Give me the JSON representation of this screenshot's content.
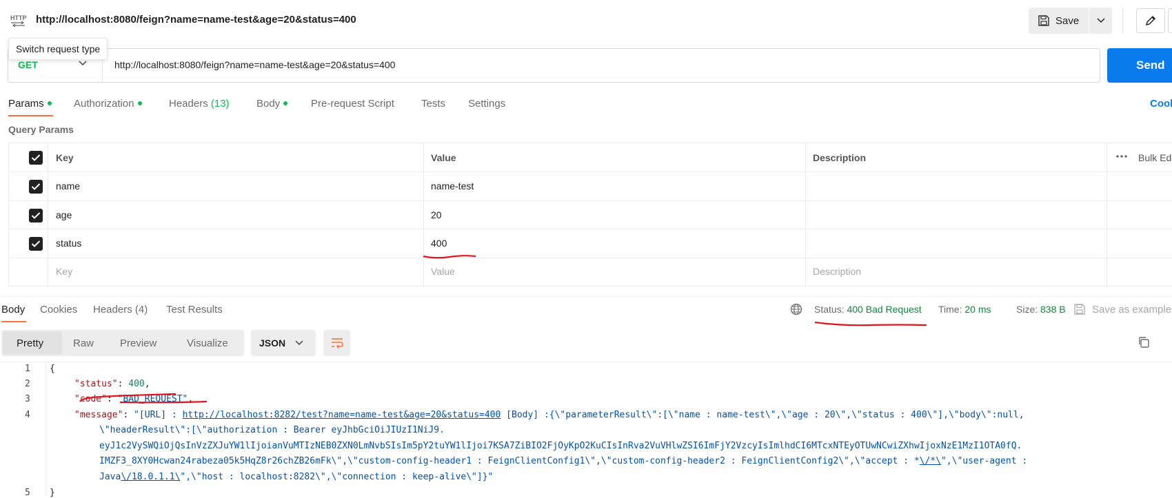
{
  "header": {
    "title": "http://localhost:8080/feign?name=name-test&age=20&status=400",
    "save_label": "Save",
    "tooltip": "Switch request type"
  },
  "request": {
    "method": "GET",
    "url": "http://localhost:8080/feign?name=name-test&age=20&status=400",
    "send_label": "Send"
  },
  "tabs": {
    "params": "Params",
    "authorization": "Authorization",
    "headers": "Headers",
    "headers_count": "(13)",
    "body": "Body",
    "prerequest": "Pre-request Script",
    "tests": "Tests",
    "settings": "Settings",
    "cookies": "Cookies"
  },
  "query_params": {
    "label": "Query Params",
    "columns": {
      "key": "Key",
      "value": "Value",
      "description": "Description",
      "bulk_edit": "Bulk Edit"
    },
    "rows": [
      {
        "key": "name",
        "value": "name-test",
        "checked": true
      },
      {
        "key": "age",
        "value": "20",
        "checked": true
      },
      {
        "key": "status",
        "value": "400",
        "checked": true
      }
    ],
    "placeholders": {
      "key": "Key",
      "value": "Value",
      "description": "Description"
    }
  },
  "response": {
    "tabs": {
      "body": "Body",
      "cookies": "Cookies",
      "headers": "Headers",
      "headers_count": "(4)",
      "test_results": "Test Results"
    },
    "status_label": "Status:",
    "status_value": "400 Bad Request",
    "time_label": "Time:",
    "time_value": "20 ms",
    "size_label": "Size:",
    "size_value": "838 B",
    "save_example": "Save as example",
    "formats": {
      "pretty": "Pretty",
      "raw": "Raw",
      "preview": "Preview",
      "visualize": "Visualize"
    },
    "language": "JSON",
    "line_numbers": [
      "1",
      "2",
      "3",
      "4",
      "5"
    ],
    "code": {
      "open_brace": "{",
      "close_brace": "}",
      "status_key": "\"status\"",
      "status_val": "400",
      "code_key": "\"code\"",
      "code_val": "\"BAD_REQUEST\"",
      "message_key": "\"message\"",
      "m1a": "\"[URL] : ",
      "m1_url": "http://localhost:8282/test?name=name-test&age=20&status=400",
      "m1b": " [Body] :{\\\"parameterResult\\\":[\\\"name : name-test\\\",\\\"age : 20\\\",\\\"status : 400\\\"],\\\"body\\\":null,",
      "m2": "\\\"headerResult\\\":[\\\"authorization : Bearer eyJhbGciOiJIUzI1NiJ9.",
      "m3": "eyJ1c2VySWQiOjQsInVzZXJuYW1lIjoianVuMTIzNEB0ZXN0LmNvbSIsIm5pY2tuYW1lIjoi7KSA7ZiBIO2FjOyKpO2KuCIsInRva2VuVHlwZSI6ImFjY2VzcyIsImlhdCI6MTcxNTEyOTUwNCwiZXhwIjoxNzE1MzI1OTA0fQ.",
      "m4a": "IMZF3_8XY0Hcwan24rabeza05k5HqZ8r26chZB26mFk\\\",\\\"custom-config-header1 : FeignClientConfig1\\\",\\\"custom-config-header2 : FeignClientConfig2\\\",\\\"accept : *",
      "m4_link": "\\/*\\",
      "m4b": "\",\\\"user-agent :",
      "m5a": "Java",
      "m5_link": "\\/18.0.1.1\\",
      "m5b": "\",\\\"host : localhost:8282\\\",\\\"connection : keep-alive\\\"]}\""
    }
  },
  "colors": {
    "accent": "#ff6c37",
    "send": "#097bed",
    "success": "#0cbb52",
    "annotation": "#e0141e"
  },
  "icons": [
    "http-icon",
    "save-icon",
    "chevron-down-icon",
    "pencil-icon",
    "globe-icon",
    "wrap-lines-icon",
    "copy-icon",
    "more-icon",
    "checkbox-icon"
  ]
}
